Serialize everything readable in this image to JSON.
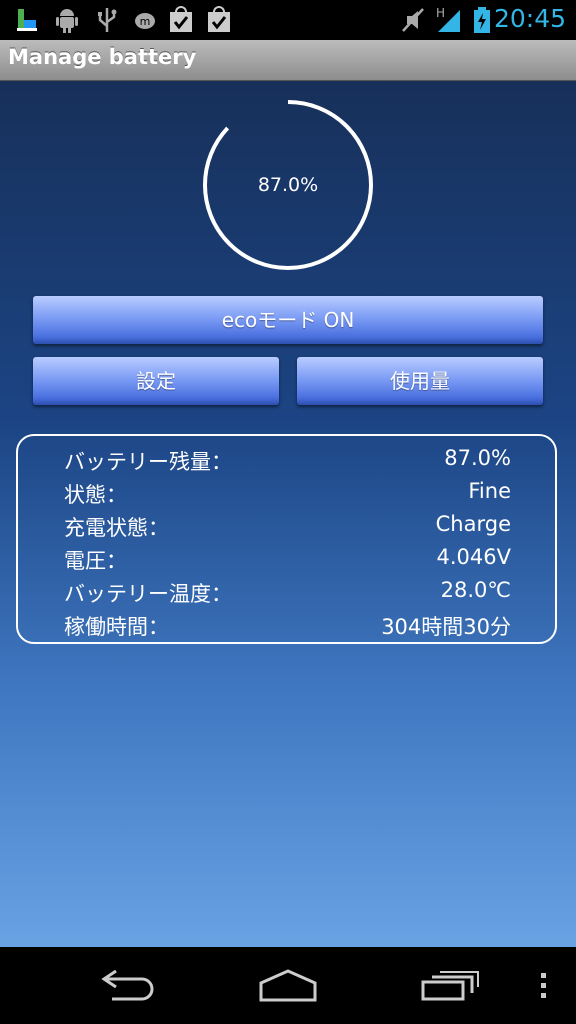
{
  "status_bar": {
    "time": "20:45",
    "network_label": "H",
    "icons": [
      "app-icon",
      "android-debug-icon",
      "usb-icon",
      "m-icon",
      "bag-check-icon",
      "bag-check-icon",
      "mute-icon",
      "signal-icon",
      "battery-charging-icon"
    ]
  },
  "title_bar": {
    "title": "Manage battery"
  },
  "battery_ring": {
    "percent_label": "87.0%",
    "level": 0.87
  },
  "buttons": {
    "eco_mode": "ecoモード ON",
    "settings": "設定",
    "usage": "使用量"
  },
  "info": {
    "rows": [
      {
        "label": "バッテリー残量：",
        "value": "87.0%"
      },
      {
        "label": "状態：",
        "value": "Fine"
      },
      {
        "label": "充電状態：",
        "value": "Charge"
      },
      {
        "label": "電圧：",
        "value": "4.046V"
      },
      {
        "label": "バッテリー温度：",
        "value": "28.0℃"
      },
      {
        "label": "稼働時間：",
        "value": "304時間30分"
      }
    ]
  },
  "nav_bar": {
    "icons": [
      "back-icon",
      "home-icon",
      "recents-icon",
      "menu-icon"
    ]
  },
  "colors": {
    "accent": "#33b5e5",
    "button_top": "#b9ccff",
    "button_bottom": "#2c4fae"
  }
}
